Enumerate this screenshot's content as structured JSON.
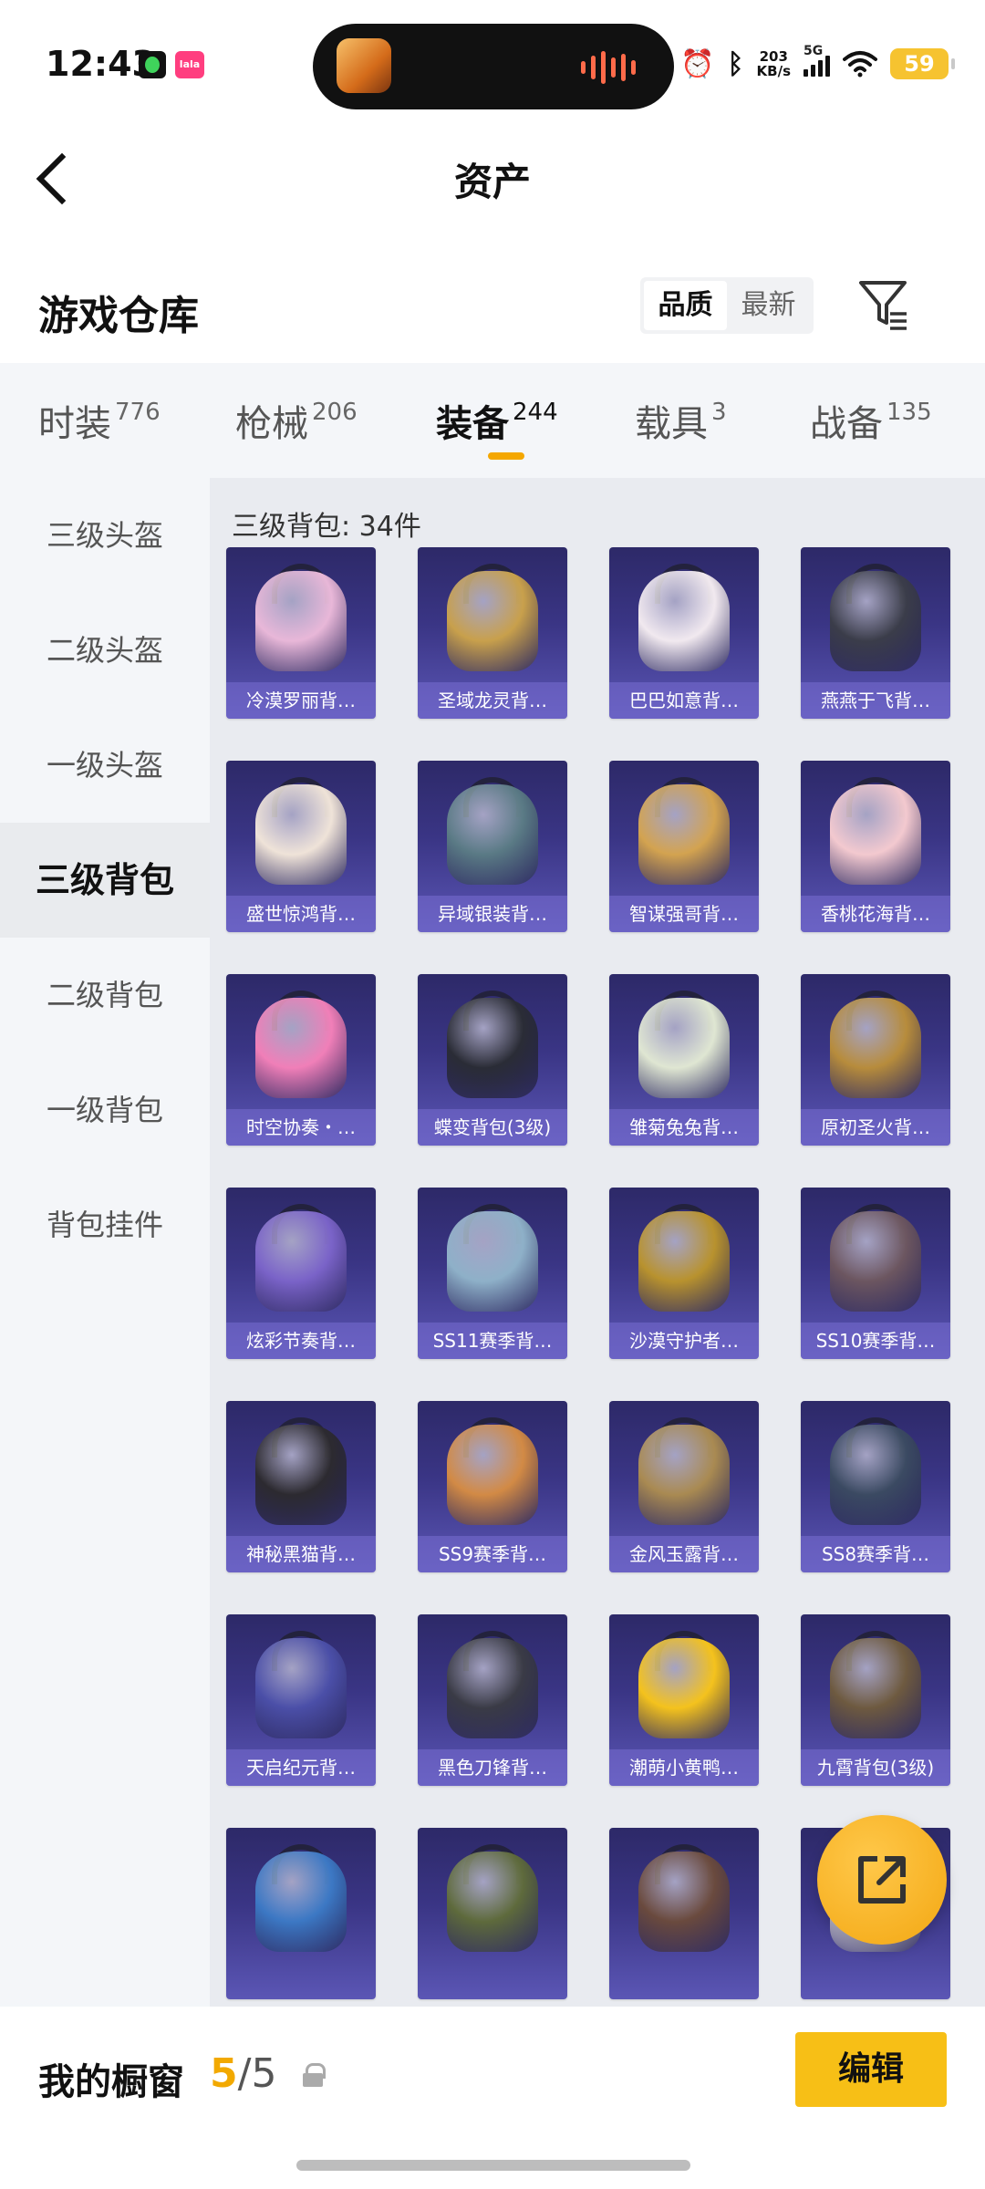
{
  "status_bar": {
    "time": "12:43",
    "network_speed_value": "203",
    "network_speed_unit": "KB/s",
    "signal_label": "5G",
    "battery_level": "59",
    "icons": [
      "wechat-app-icon",
      "pink-app-icon",
      "alarm-icon",
      "bluetooth-icon",
      "signal-icon",
      "wifi-icon",
      "battery-icon"
    ]
  },
  "header": {
    "title": "资产"
  },
  "warehouse": {
    "title": "游戏仓库",
    "sort_options": [
      "品质",
      "最新"
    ],
    "sort_selected": "品质"
  },
  "tabs": [
    {
      "label": "时装",
      "count": "776"
    },
    {
      "label": "枪械",
      "count": "206"
    },
    {
      "label": "装备",
      "count": "244",
      "active": true
    },
    {
      "label": "载具",
      "count": "3"
    },
    {
      "label": "战备",
      "count": "135"
    }
  ],
  "sidebar": {
    "items": [
      "三级头盔",
      "二级头盔",
      "一级头盔",
      "三级背包",
      "二级背包",
      "一级背包",
      "背包挂件"
    ],
    "selected": "三级背包"
  },
  "grid": {
    "caption": "三级背包: 34件",
    "items": [
      {
        "label": "冷漠罗丽背…",
        "color": "#e8b7d8"
      },
      {
        "label": "圣域龙灵背…",
        "color": "#c8a04c"
      },
      {
        "label": "巴巴如意背…",
        "color": "#f1e9ef"
      },
      {
        "label": "燕燕于飞背…",
        "color": "#3b3d4a"
      },
      {
        "label": "盛世惊鸿背…",
        "color": "#efe3d8"
      },
      {
        "label": "异域银装背…",
        "color": "#5a7a85"
      },
      {
        "label": "智谋强哥背…",
        "color": "#d3a350"
      },
      {
        "label": "香桃花海背…",
        "color": "#f3c9cf"
      },
      {
        "label": "时空协奏・…",
        "color": "#f07fb8"
      },
      {
        "label": "蝶变背包(3级)",
        "color": "#2a2c36"
      },
      {
        "label": "雏菊兔兔背…",
        "color": "#dfe6d2"
      },
      {
        "label": "原初圣火背…",
        "color": "#b78c3c"
      },
      {
        "label": "炫彩节奏背…",
        "color": "#7a63c8"
      },
      {
        "label": "SS11赛季背…",
        "color": "#8eb0c8"
      },
      {
        "label": "沙漠守护者…",
        "color": "#b8922e"
      },
      {
        "label": "SS10赛季背…",
        "color": "#6c5660"
      },
      {
        "label": "神秘黑猫背…",
        "color": "#2c2a30"
      },
      {
        "label": "SS9赛季背…",
        "color": "#d28a45"
      },
      {
        "label": "金风玉露背…",
        "color": "#a98a52"
      },
      {
        "label": "SS8赛季背…",
        "color": "#3b4a62"
      },
      {
        "label": "天启纪元背…",
        "color": "#4b4fa8"
      },
      {
        "label": "黑色刀锋背…",
        "color": "#3a3b46"
      },
      {
        "label": "潮萌小黄鸭…",
        "color": "#f4c21d"
      },
      {
        "label": "九霄背包(3级)",
        "color": "#6e5a40"
      },
      {
        "label": "",
        "color": "#3c78c4"
      },
      {
        "label": "",
        "color": "#5e6a3c"
      },
      {
        "label": "",
        "color": "#6a4a3e"
      },
      {
        "label": "",
        "color": "#e9e6f0"
      }
    ]
  },
  "showcase": {
    "label": "我的橱窗",
    "current": "5",
    "total": "/5",
    "edit_label": "编辑"
  },
  "colors": {
    "accent": "#f7bf16",
    "tab_indicator": "#f4a700",
    "card_bg": "#3a3585"
  }
}
